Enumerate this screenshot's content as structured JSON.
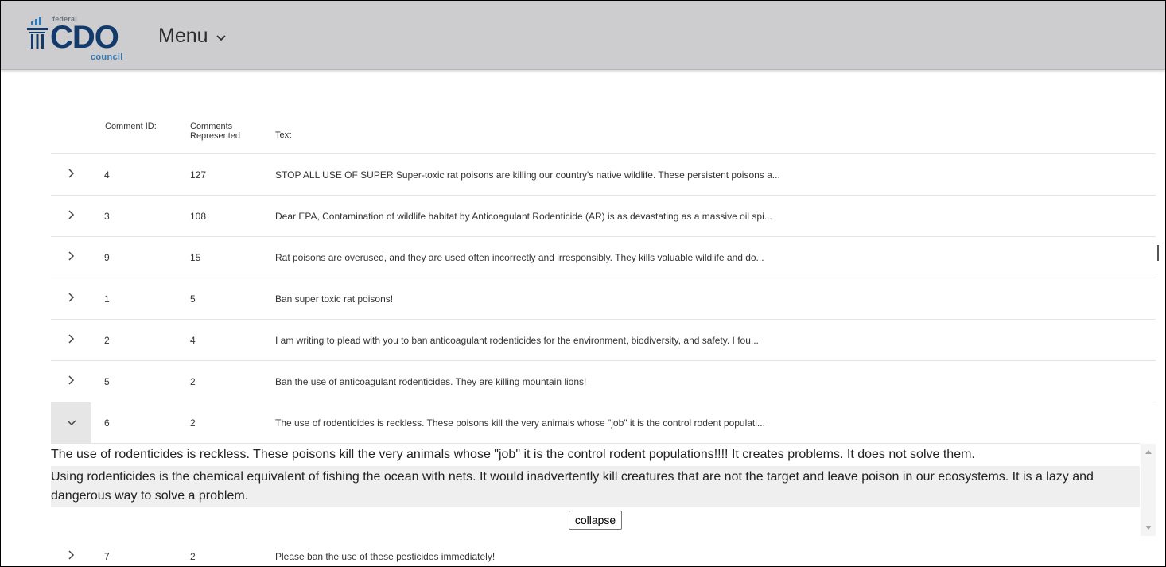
{
  "header": {
    "logo": {
      "top": "federal",
      "main": "CDO",
      "bottom": "council"
    },
    "menu_label": "Menu"
  },
  "table": {
    "columns": [
      "Comment ID:",
      "Comments Represented",
      "Text"
    ],
    "rows": [
      {
        "id": "4",
        "count": "127",
        "text": "STOP ALL USE OF SUPER Super-toxic rat poisons are killing our country's native wildlife. These persistent poisons a..."
      },
      {
        "id": "3",
        "count": "108",
        "text": "Dear EPA, Contamination of wildlife habitat by Anticoagulant Rodenticide (AR) is as devastating as a massive oil spi..."
      },
      {
        "id": "9",
        "count": "15",
        "text": "Rat poisons are overused, and they are used often incorrectly and irresponsibly. They kills valuable wildlife and do..."
      },
      {
        "id": "1",
        "count": "5",
        "text": "Ban super toxic rat poisons!"
      },
      {
        "id": "2",
        "count": "4",
        "text": "I am writing to plead with you to ban anticoagulant rodenticides for the environment, biodiversity, and safety. I fou..."
      },
      {
        "id": "5",
        "count": "2",
        "text": "Ban the use of anticoagulant rodenticides. They are killing mountain lions!"
      },
      {
        "id": "6",
        "count": "2",
        "text": "The use of rodenticides is reckless. These poisons kill the very animals whose \"job\" it is the control rodent populati..."
      },
      {
        "id": "7",
        "count": "2",
        "text": "Please ban the use of these pesticides immediately!"
      }
    ],
    "expanded_row_index": 6,
    "expanded_detail": {
      "paragraphs": [
        "The use of rodenticides is reckless. These poisons kill the very animals whose \"job\" it is the control rodent populations!!!! It creates problems. It does not solve them.",
        "Using rodenticides is the chemical equivalent of fishing the ocean with nets. It would inadvertently kill creatures that are not the target and leave poison in our ecosystems. It is a lazy and dangerous way to solve a problem."
      ],
      "collapse_label": "collapse"
    }
  },
  "icons": {
    "row_expand": "chevron-right-icon",
    "row_collapse": "chevron-down-icon",
    "menu": "chevron-down-icon",
    "logo": "capitol-chart-icon"
  },
  "colors": {
    "header_bg": "#cdcdcf",
    "logo_dark": "#123a6a",
    "logo_accent": "#2f78b4",
    "expanded_expander_bg": "#e6e6e6",
    "detail_alt_bg": "#efefef"
  }
}
